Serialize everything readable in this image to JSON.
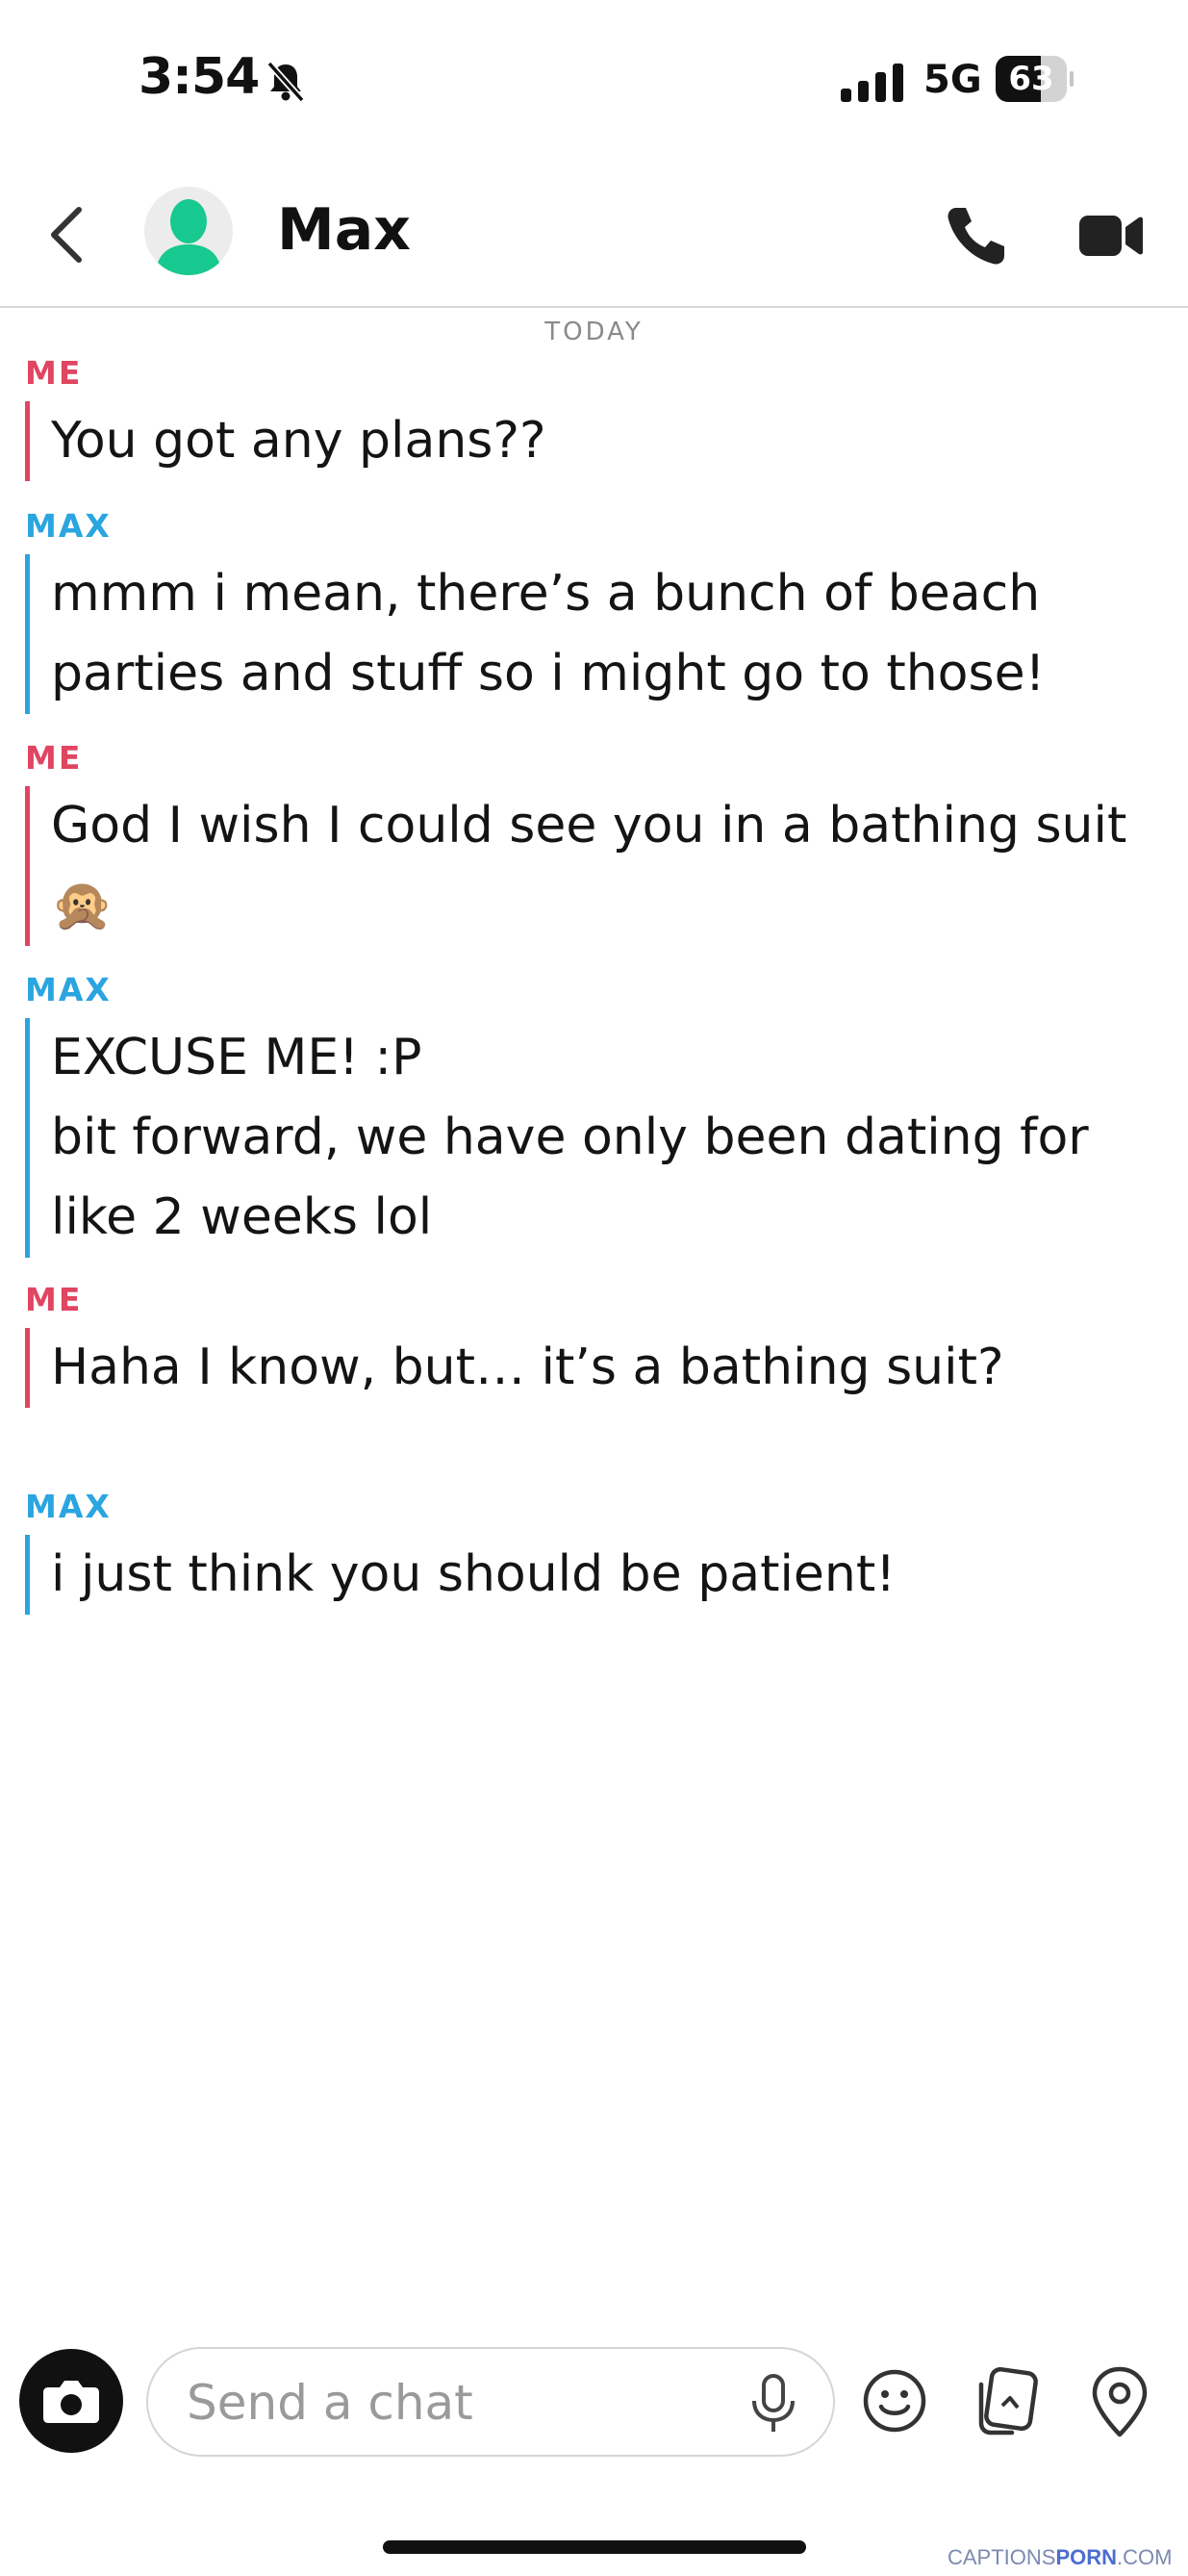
{
  "status_bar": {
    "time": "3:54",
    "network": "5G",
    "battery": "63",
    "battery_level": 0.63
  },
  "header": {
    "contact_name": "Max",
    "icons": [
      "back-chevron",
      "avatar",
      "phone-icon",
      "video-icon"
    ]
  },
  "date_divider": "TODAY",
  "messages": [
    {
      "sender": "ME",
      "lines": [
        "You got any plans??"
      ]
    },
    {
      "sender": "MAX",
      "lines": [
        "mmm i mean, there’s a bunch of beach",
        "parties and stuff so i might go to those!"
      ]
    },
    {
      "sender": "ME",
      "lines": [
        "God I wish I could see you in a bathing suit",
        "🙊"
      ]
    },
    {
      "sender": "MAX",
      "lines": [
        "EXCUSE ME! :P",
        "bit forward, we have only been dating for",
        "like 2 weeks lol"
      ]
    },
    {
      "sender": "ME",
      "lines": [
        "Haha I know, but… it’s a bathing suit?"
      ]
    },
    {
      "sender": "MAX",
      "lines": [
        "i just think you should be patient!"
      ]
    }
  ],
  "composer": {
    "placeholder": "Send a chat",
    "icons": [
      "camera-icon",
      "mic-icon",
      "emoji-icon",
      "memories-icon",
      "location-pin-icon"
    ]
  },
  "watermark": {
    "part1": "CAPTIONS",
    "part2": "PORN",
    "part3": ".COM"
  },
  "colors": {
    "me": "#e04561",
    "max": "#2aa5e0",
    "avatar": "#17c98f"
  }
}
